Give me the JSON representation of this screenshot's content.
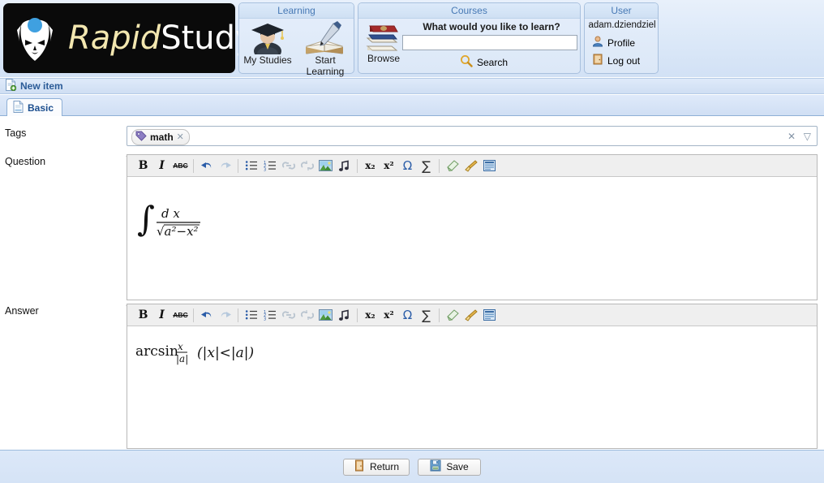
{
  "brand": {
    "name_part1": "Rapid",
    "name_part2": "Study",
    "mask_icon": "mask-face-icon",
    "dot_color": "#3fa0e0"
  },
  "header": {
    "learning": {
      "title": "Learning",
      "items": [
        {
          "label": "My Studies",
          "icon": "graduate-student-icon"
        },
        {
          "label": "Start Learning",
          "icon": "open-book-pen-icon"
        }
      ]
    },
    "courses": {
      "title": "Courses",
      "browse_label": "Browse",
      "browse_icon": "stacked-books-icon",
      "search_prompt": "What would you like to learn?",
      "search_value": "",
      "search_placeholder": "",
      "search_button_label": "Search",
      "search_icon": "magnifier-icon"
    },
    "user": {
      "title": "User",
      "username": "adam.dziendziel",
      "profile_label": "Profile",
      "profile_icon": "person-icon",
      "logout_label": "Log out",
      "logout_icon": "door-icon"
    }
  },
  "breadcrumb": {
    "label": "New item",
    "icon": "new-page-icon"
  },
  "tabs": [
    {
      "label": "Basic",
      "icon": "document-icon",
      "active": true
    }
  ],
  "form": {
    "tags": {
      "label": "Tags",
      "chips": [
        {
          "label": "math",
          "icon": "tag-icon",
          "remove_icon": "close-icon"
        }
      ],
      "clear_icon": "clear-x-icon",
      "dropdown_icon": "dropdown-triangle-icon"
    },
    "question": {
      "label": "Question",
      "content_type": "math-formula-image",
      "content_latex": "\\int \\frac{d\\,x}{\\sqrt{a^2 - x^2}}",
      "content_plain": "∫ dx / √(a² − x²)"
    },
    "answer": {
      "label": "Answer",
      "content_type": "math-formula-image",
      "content_latex": "\\arcsin\\frac{x}{|a|}\\;(|x|<|a|)",
      "content_plain": "arcsin x/|a|  (|x|<|a|)"
    }
  },
  "editor_toolbar": {
    "buttons": [
      {
        "name": "bold",
        "glyph": "B",
        "style": "bold",
        "state": "enabled"
      },
      {
        "name": "italic",
        "glyph": "I",
        "style": "italic",
        "state": "enabled"
      },
      {
        "name": "strikethrough",
        "glyph": "ABC",
        "style": "strike",
        "state": "enabled"
      },
      {
        "name": "separator",
        "glyph": "",
        "style": "sep",
        "state": "none"
      },
      {
        "name": "undo",
        "glyph": "↺",
        "style": "blue",
        "state": "enabled"
      },
      {
        "name": "redo",
        "glyph": "↻",
        "style": "dim",
        "state": "disabled"
      },
      {
        "name": "separator",
        "glyph": "",
        "style": "sep",
        "state": "none"
      },
      {
        "name": "bulleted-list",
        "glyph": "≔",
        "style": "blue",
        "state": "enabled"
      },
      {
        "name": "numbered-list",
        "glyph": "≕",
        "style": "blue",
        "state": "enabled"
      },
      {
        "name": "insert-link",
        "glyph": "🔗",
        "style": "dim",
        "state": "disabled"
      },
      {
        "name": "unlink",
        "glyph": "⛓",
        "style": "dim",
        "state": "disabled"
      },
      {
        "name": "insert-image",
        "glyph": "🖼",
        "style": "image",
        "state": "enabled"
      },
      {
        "name": "insert-audio",
        "glyph": "♫",
        "style": "plain",
        "state": "enabled"
      },
      {
        "name": "separator",
        "glyph": "",
        "style": "sep",
        "state": "none"
      },
      {
        "name": "subscript",
        "glyph": "x₂",
        "style": "plain",
        "state": "enabled"
      },
      {
        "name": "superscript",
        "glyph": "x²",
        "style": "plain",
        "state": "enabled"
      },
      {
        "name": "special-char",
        "glyph": "Ω",
        "style": "blue",
        "state": "enabled"
      },
      {
        "name": "math-formula",
        "glyph": "Σ",
        "style": "plain",
        "state": "enabled"
      },
      {
        "name": "separator",
        "glyph": "",
        "style": "sep",
        "state": "none"
      },
      {
        "name": "remove-format",
        "glyph": "⌫",
        "style": "eraser",
        "state": "enabled"
      },
      {
        "name": "format-painter",
        "glyph": "🖌",
        "style": "brush",
        "state": "enabled"
      },
      {
        "name": "source-view",
        "glyph": "▤",
        "style": "panel",
        "state": "enabled"
      }
    ]
  },
  "footer": {
    "return_label": "Return",
    "return_icon": "door-icon",
    "save_label": "Save",
    "save_icon": "floppy-disk-icon"
  }
}
